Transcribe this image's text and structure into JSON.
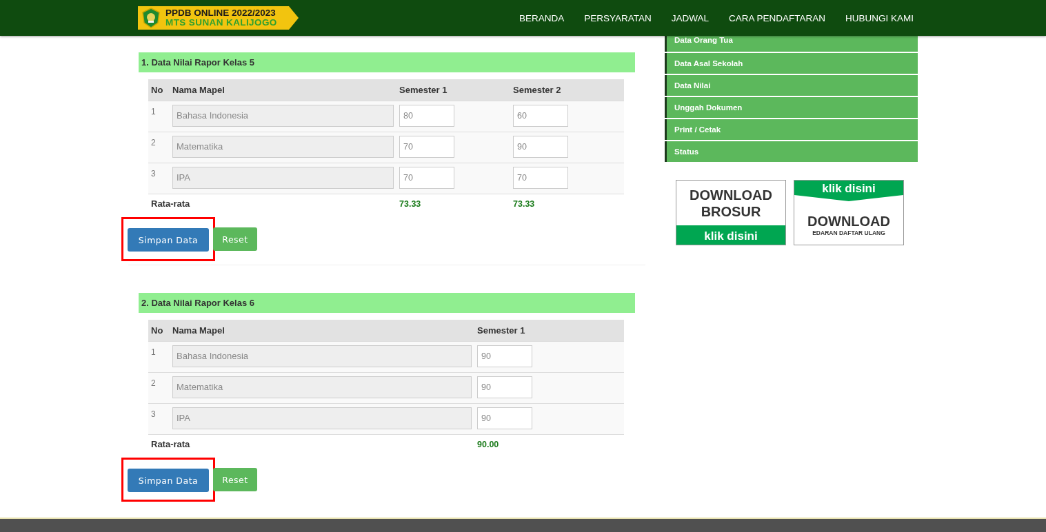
{
  "header": {
    "logo": {
      "line_1": "PPDB ONLINE 2022/2023",
      "line_2": "MTS SUNAN KALIJOGO"
    },
    "nav": [
      "BERANDA",
      "PERSYARATAN",
      "JADWAL",
      "CARA PENDAFTARAN",
      "HUBUNGI KAMI"
    ]
  },
  "sections": [
    {
      "title": "1. Data Nilai Rapor Kelas 5",
      "columns": [
        "No",
        "Nama Mapel",
        "Semester 1",
        "Semester 2"
      ],
      "rows": [
        {
          "no": "1",
          "subject": "Bahasa Indonesia",
          "scores": [
            "80",
            "60"
          ]
        },
        {
          "no": "2",
          "subject": "Matematika",
          "scores": [
            "70",
            "90"
          ]
        },
        {
          "no": "3",
          "subject": "IPA",
          "scores": [
            "70",
            "70"
          ]
        }
      ],
      "average": {
        "label": "Rata-rata",
        "values": [
          "73.33",
          "73.33"
        ]
      },
      "buttons": [
        {
          "label": "Simpan Data",
          "kind": "primary",
          "highlighted": true
        },
        {
          "label": "Reset",
          "kind": "success",
          "highlighted": false
        }
      ]
    },
    {
      "title": "2. Data Nilai Rapor Kelas 6",
      "columns": [
        "No",
        "Nama Mapel",
        "Semester 1"
      ],
      "rows": [
        {
          "no": "1",
          "subject": "Bahasa Indonesia",
          "scores": [
            "90"
          ]
        },
        {
          "no": "2",
          "subject": "Matematika",
          "scores": [
            "90"
          ]
        },
        {
          "no": "3",
          "subject": "IPA",
          "scores": [
            "90"
          ]
        }
      ],
      "average": {
        "label": "Rata-rata",
        "values": [
          "90.00"
        ]
      },
      "buttons": [
        {
          "label": "Simpan Data",
          "kind": "primary",
          "highlighted": true
        },
        {
          "label": "Reset",
          "kind": "success",
          "highlighted": false
        }
      ]
    }
  ],
  "sidebar": {
    "items": [
      "Data Orang Tua",
      "Data Asal Sekolah",
      "Data Nilai",
      "Unggah Dokumen",
      "Print / Cetak",
      "Status"
    ]
  },
  "banners": [
    {
      "kind": "brosur",
      "lines": [
        "DOWNLOAD",
        "BROSUR"
      ],
      "link": "klik disini"
    },
    {
      "kind": "edaran",
      "lines": [
        "DOWNLOAD",
        "EDARAN DAFTAR ULANG"
      ],
      "link": "klik disini"
    }
  ]
}
